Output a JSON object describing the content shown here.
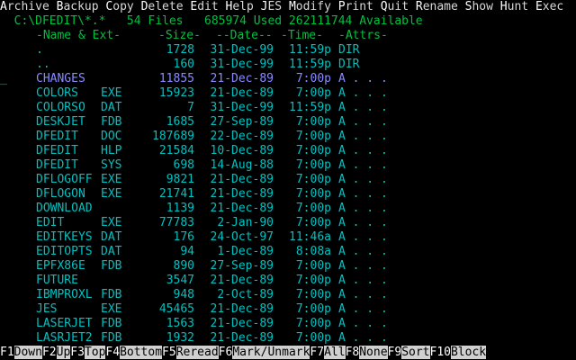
{
  "menu": [
    {
      "hot": "A",
      "rest": "rchive"
    },
    {
      "hot": "B",
      "rest": "ackup"
    },
    {
      "hot": "C",
      "rest": "opy"
    },
    {
      "hot": "D",
      "rest": "elete"
    },
    {
      "hot": "E",
      "rest": "dit"
    },
    {
      "hot": "H",
      "rest": "elp"
    },
    {
      "hot": "J",
      "rest": "ES"
    },
    {
      "hot": "M",
      "rest": "odify"
    },
    {
      "hot": "P",
      "rest": "rint"
    },
    {
      "hot": "Q",
      "rest": "uit"
    },
    {
      "hot": "R",
      "rest": "ename"
    },
    {
      "hot": "S",
      "rest": "how"
    },
    {
      "hot": "H",
      "rest": "unt"
    },
    {
      "hot": "E",
      "rest": "xec"
    }
  ],
  "path": {
    "directory": "C:\\DFEDIT\\*.*",
    "files": "54 Files",
    "used": "685974 Used",
    "available": "262111744 Available"
  },
  "columns": {
    "name": "-Name & Ext-",
    "size": "-Size-",
    "date": "--Date--",
    "time": "-Time-",
    "attrs": "-Attrs-"
  },
  "cursor_mark": "_",
  "files": [
    {
      "name": ".",
      "ext": "",
      "size": "1728",
      "date": "31-Dec-99",
      "time": "11:59p",
      "attr": "DIR"
    },
    {
      "name": "..",
      "ext": "",
      "size": "160",
      "date": "31-Dec-99",
      "time": "11:59p",
      "attr": "DIR"
    },
    {
      "name": "CHANGES",
      "ext": "",
      "size": "11855",
      "date": "21-Dec-89",
      "time": "7:00p",
      "attr": "A . . ."
    },
    {
      "name": "COLORS",
      "ext": "EXE",
      "size": "15923",
      "date": "21-Dec-89",
      "time": "7:00p",
      "attr": "A . . ."
    },
    {
      "name": "COLORSO",
      "ext": "DAT",
      "size": "7",
      "date": "31-Dec-99",
      "time": "11:59p",
      "attr": "A . . ."
    },
    {
      "name": "DESKJET",
      "ext": "FDB",
      "size": "1685",
      "date": "27-Sep-89",
      "time": "7:00p",
      "attr": "A . . ."
    },
    {
      "name": "DFEDIT",
      "ext": "DOC",
      "size": "187689",
      "date": "22-Dec-89",
      "time": "7:00p",
      "attr": "A . . ."
    },
    {
      "name": "DFEDIT",
      "ext": "HLP",
      "size": "21584",
      "date": "10-Dec-89",
      "time": "7:00p",
      "attr": "A . . ."
    },
    {
      "name": "DFEDIT",
      "ext": "SYS",
      "size": "698",
      "date": "14-Aug-88",
      "time": "7:00p",
      "attr": "A . . ."
    },
    {
      "name": "DFLOGOFF",
      "ext": "EXE",
      "size": "9821",
      "date": "21-Dec-89",
      "time": "7:00p",
      "attr": "A . . ."
    },
    {
      "name": "DFLOGON",
      "ext": "EXE",
      "size": "21741",
      "date": "21-Dec-89",
      "time": "7:00p",
      "attr": "A . . ."
    },
    {
      "name": "DOWNLOAD",
      "ext": "",
      "size": "1139",
      "date": "21-Dec-89",
      "time": "7:00p",
      "attr": "A . . ."
    },
    {
      "name": "EDIT",
      "ext": "EXE",
      "size": "77783",
      "date": "2-Jan-90",
      "time": "7:00p",
      "attr": "A . . ."
    },
    {
      "name": "EDITKEYS",
      "ext": "DAT",
      "size": "176",
      "date": "24-Oct-97",
      "time": "11:46a",
      "attr": "A . . ."
    },
    {
      "name": "EDITOPTS",
      "ext": "DAT",
      "size": "94",
      "date": "1-Dec-89",
      "time": "8:08a",
      "attr": "A . . ."
    },
    {
      "name": "EPFX86E",
      "ext": "FDB",
      "size": "890",
      "date": "27-Sep-89",
      "time": "7:00p",
      "attr": "A . . ."
    },
    {
      "name": "FUTURE",
      "ext": "",
      "size": "3547",
      "date": "21-Dec-89",
      "time": "7:00p",
      "attr": "A . . ."
    },
    {
      "name": "IBMPROXL",
      "ext": "FDB",
      "size": "948",
      "date": "2-Oct-89",
      "time": "7:00p",
      "attr": "A . . ."
    },
    {
      "name": "JES",
      "ext": "EXE",
      "size": "45465",
      "date": "21-Dec-89",
      "time": "7:00p",
      "attr": "A . . ."
    },
    {
      "name": "LASERJET",
      "ext": "FDB",
      "size": "1563",
      "date": "21-Dec-89",
      "time": "7:00p",
      "attr": "A . . ."
    },
    {
      "name": "LASRJET2",
      "ext": "FDB",
      "size": "1932",
      "date": "21-Dec-89",
      "time": "7:00p",
      "attr": "A . . ."
    }
  ],
  "selected_index": 2,
  "fkeys": [
    {
      "num": "F1",
      "label": "Down"
    },
    {
      "num": "F2",
      "label": "Up"
    },
    {
      "num": "F3",
      "label": "Top"
    },
    {
      "num": "F4",
      "label": "Bottom"
    },
    {
      "num": "F5",
      "label": "Reread"
    },
    {
      "num": "F6",
      "label": "Mark/Unmark"
    },
    {
      "num": "F7",
      "label": "All"
    },
    {
      "num": "F8",
      "label": "None"
    },
    {
      "num": "F9",
      "label": "Sort"
    },
    {
      "num": "F10",
      "label": "Block"
    }
  ],
  "colors": {
    "background": "#000000",
    "menu_text": "#d8d8d8",
    "header_green": "#00c040",
    "list_cyan": "#00c0c0",
    "selected_blue": "#8a8aff",
    "fkey_bar": "#d0d0d0"
  }
}
